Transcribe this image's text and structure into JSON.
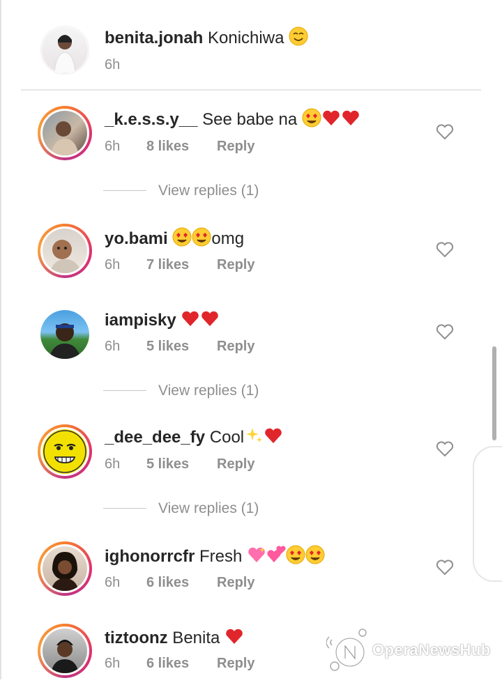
{
  "comments": [
    {
      "user": "benita.jonah",
      "text": "Konichiwa ",
      "emojis": [
        "smile"
      ],
      "time": "6h",
      "likes": "",
      "reply": "",
      "ring": false,
      "heart": false
    },
    {
      "user": "_k.e.s.s.y__",
      "text": " See babe na ",
      "emojis": [
        "heart-eyes",
        "heart",
        "heart"
      ],
      "time": "6h",
      "likes": "8 likes",
      "reply": "Reply",
      "ring": true,
      "heart": true
    },
    {
      "user": "yo.bami",
      "text": "omg",
      "emojis_before_text": [
        "heart-eyes",
        "heart-eyes"
      ],
      "time": "6h",
      "likes": "7 likes",
      "reply": "Reply",
      "ring": true,
      "heart": true
    },
    {
      "user": "iampisky",
      "text": " ",
      "emojis": [
        "heart",
        "heart"
      ],
      "time": "6h",
      "likes": "5 likes",
      "reply": "Reply",
      "ring": false,
      "heart": true
    },
    {
      "user": "_dee_dee_fy",
      "text": " Cool",
      "emojis": [
        "sparkles",
        "heart"
      ],
      "time": "6h",
      "likes": "5 likes",
      "reply": "Reply",
      "ring": true,
      "heart": true
    },
    {
      "user": "ighonorrcfr",
      "text": " Fresh ",
      "emojis": [
        "sparkling-heart",
        "two-hearts",
        "heart-eyes",
        "heart-eyes"
      ],
      "time": "6h",
      "likes": "6 likes",
      "reply": "Reply",
      "ring": true,
      "heart": true
    },
    {
      "user": "tiztoonz",
      "text": " Benita ",
      "emojis": [
        "heart"
      ],
      "time": "6h",
      "likes": "6 likes",
      "reply": "Reply",
      "ring": true,
      "heart": true
    }
  ],
  "view_replies": [
    "View replies (1)",
    "View replies (1)",
    "View replies (1)"
  ],
  "watermark": "OperaNewsHub",
  "colors": {
    "heart_red": "#e0262a",
    "meta_gray": "#8e8e8e",
    "username": "#262626",
    "ring_orange": "#f77f2e",
    "ring_pink": "#e1306c"
  }
}
